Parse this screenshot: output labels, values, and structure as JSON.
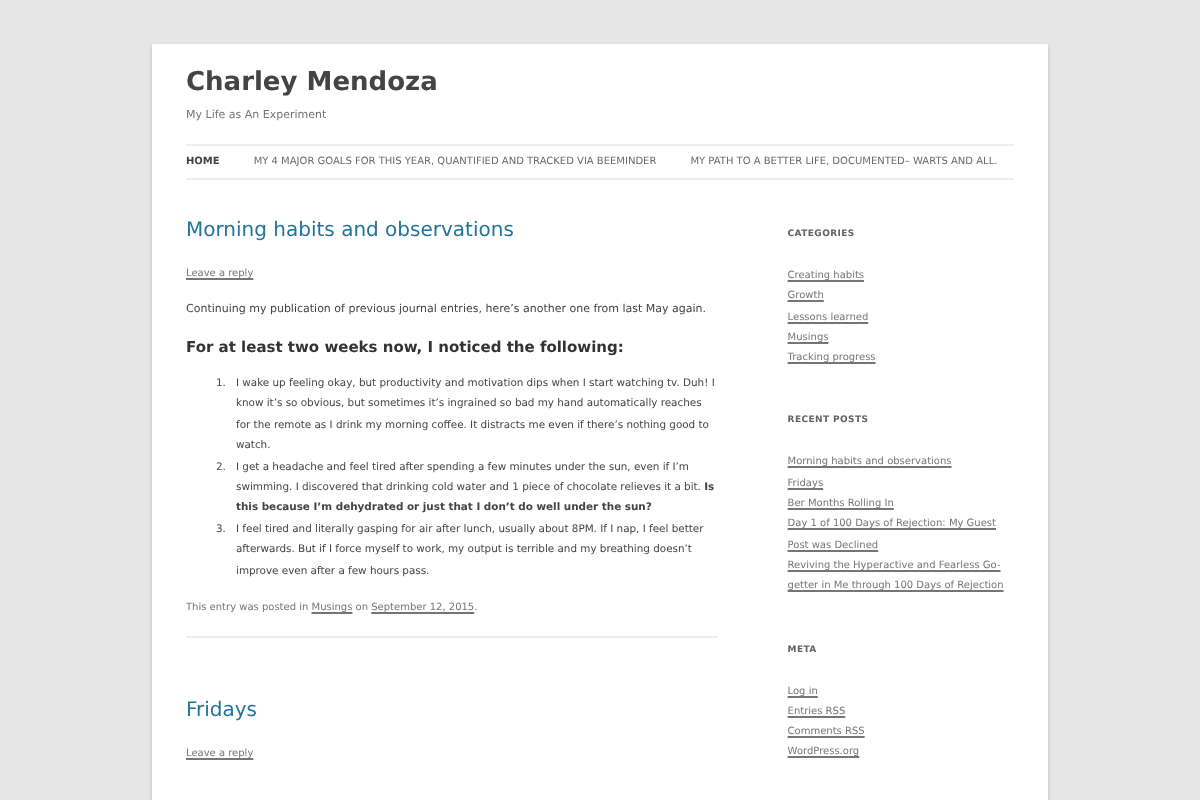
{
  "site": {
    "title": "Charley Mendoza",
    "tagline": "My Life as An Experiment"
  },
  "nav": [
    {
      "label": "HOME",
      "selected": true
    },
    {
      "label": "MY 4 MAJOR GOALS FOR THIS YEAR, QUANTIFIED AND TRACKED VIA BEEMINDER",
      "selected": false
    },
    {
      "label": "MY PATH TO A BETTER LIFE, DOCUMENTED– WARTS AND ALL.",
      "selected": false
    }
  ],
  "posts": [
    {
      "title": "Morning habits and observations",
      "reply_link": "Leave a reply",
      "intro": "Continuing my publication of previous journal entries, here’s another one from last May again.",
      "heading": "For at least two weeks now, I noticed the following:",
      "list": [
        {
          "marker": "1.",
          "text": "I wake up feeling okay, but productivity and motivation dips when I start watching tv. Duh! I know it’s so obvious, but sometimes it’s ingrained so bad my hand automatically reaches for the remote as I drink my morning coffee. It distracts me even if there’s nothing good to watch."
        },
        {
          "marker": "2.",
          "text": "I get a headache and feel tired after spending a few minutes under the sun, even if I’m swimming. I discovered that drinking cold water and 1 piece of chocolate relieves it a bit. **Is this because I’m dehydrated or just that I don’t do well under the sun?**"
        },
        {
          "marker": "3.",
          "text": "I feel tired and literally gasping for air after lunch, usually about 8PM. If I nap, I feel better afterwards. But if I force myself to work, my output is terrible and my breathing doesn’t improve even after a few hours pass."
        }
      ],
      "footer": {
        "prefix": "This entry was posted in",
        "category": "Musings",
        "middle": "on",
        "date": "September 12, 2015",
        "suffix": "."
      }
    },
    {
      "title": "Fridays",
      "reply_link": "Leave a reply"
    }
  ],
  "sidebar": [
    {
      "heading": "CATEGORIES",
      "links": [
        "Creating habits",
        "Growth",
        "Lessons learned",
        "Musings",
        "Tracking progress"
      ]
    },
    {
      "heading": "RECENT POSTS",
      "links": [
        "Morning habits and observations",
        "Fridays",
        "Ber Months Rolling In",
        "Day 1 of 100 Days of Rejection: My Guest Post was Declined",
        "Reviving the Hyperactive and Fearless Go-getter in Me through 100 Days of Rejection"
      ]
    },
    {
      "heading": "META",
      "links": [
        "Log in",
        "Entries RSS",
        "Comments RSS",
        "WordPress.org"
      ]
    }
  ]
}
